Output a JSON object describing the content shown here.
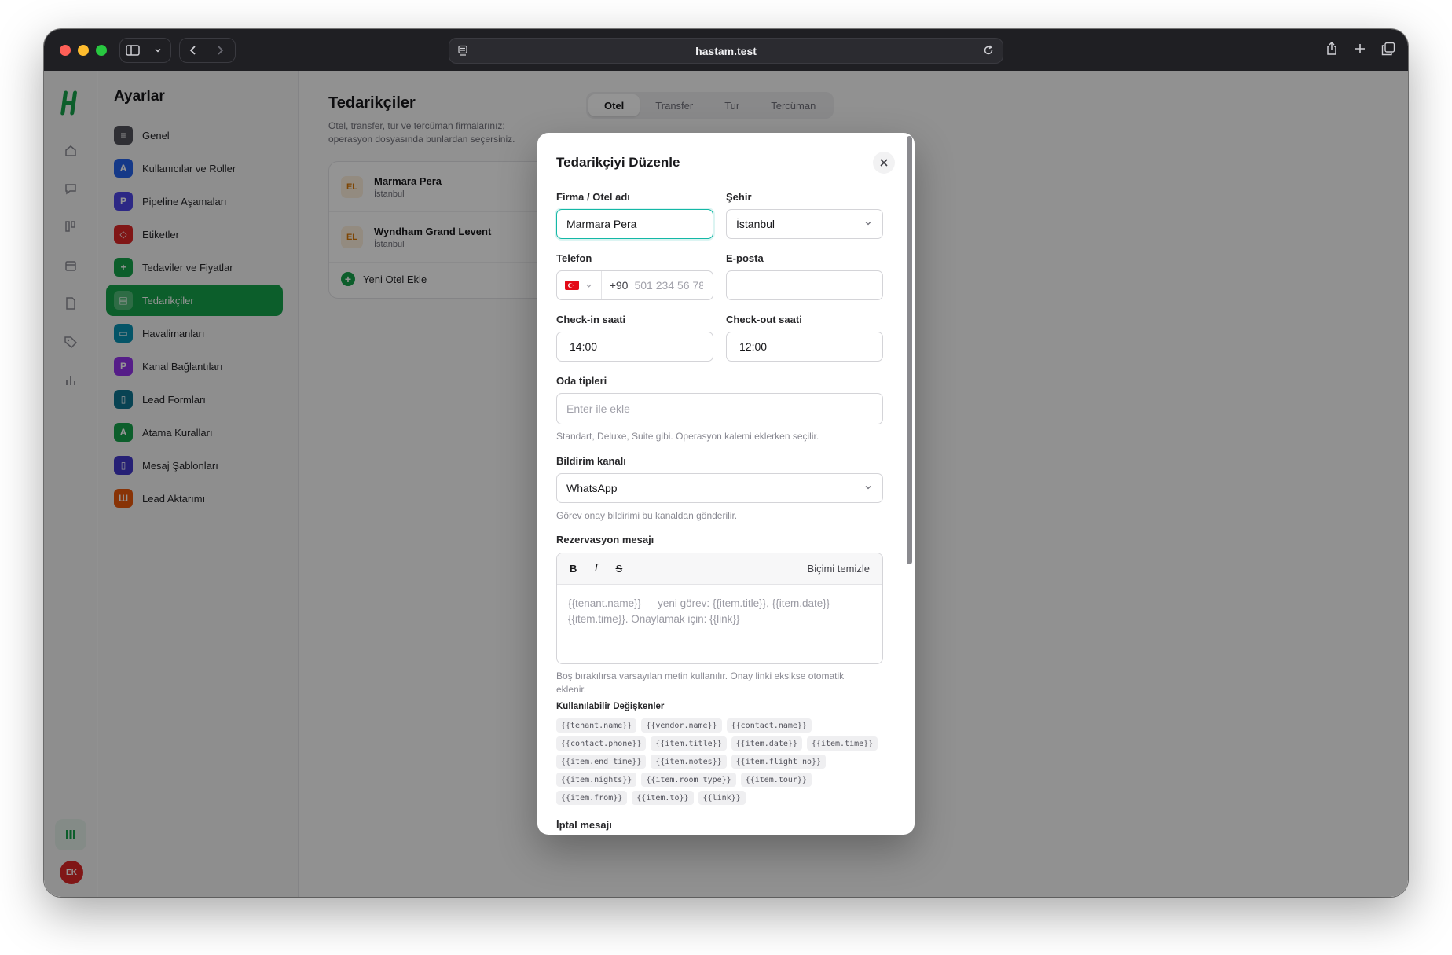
{
  "browser": {
    "url": "hastam.test"
  },
  "rail": {
    "avatar_initials": "EK",
    "icons": [
      "home-icon",
      "chat-icon",
      "pipeline-icon",
      "calendar-icon",
      "document-icon",
      "tags-icon",
      "chart-icon"
    ]
  },
  "settings": {
    "title": "Ayarlar",
    "items": [
      {
        "label": "Genel",
        "color": "#52525b",
        "glyph": "≡"
      },
      {
        "label": "Kullanıcılar ve Roller",
        "color": "#2563eb",
        "glyph": "A"
      },
      {
        "label": "Pipeline Aşamaları",
        "color": "#4f46e5",
        "glyph": "P"
      },
      {
        "label": "Etiketler",
        "color": "#dc2626",
        "glyph": "◇"
      },
      {
        "label": "Tedaviler ve Fiyatlar",
        "color": "#16a34a",
        "glyph": "+"
      },
      {
        "label": "Tedarikçiler",
        "color": "#15803d",
        "glyph": "▤",
        "active": true
      },
      {
        "label": "Havalimanları",
        "color": "#0891b2",
        "glyph": "▭"
      },
      {
        "label": "Kanal Bağlantıları",
        "color": "#9333ea",
        "glyph": "P"
      },
      {
        "label": "Lead Formları",
        "color": "#0e7490",
        "glyph": "▯"
      },
      {
        "label": "Atama Kuralları",
        "color": "#16a34a",
        "glyph": "A"
      },
      {
        "label": "Mesaj Şablonları",
        "color": "#4338ca",
        "glyph": "▯"
      },
      {
        "label": "Lead Aktarımı",
        "color": "#ea580c",
        "glyph": "Ш"
      }
    ]
  },
  "main": {
    "title": "Tedarikçiler",
    "description": "Otel, transfer, tur ve tercüman firmalarınız; operasyon dosyasında bunlardan seçersiniz.",
    "tabs": [
      "Otel",
      "Transfer",
      "Tur",
      "Tercüman"
    ],
    "active_tab": "Otel",
    "vendors": [
      {
        "badge": "EL",
        "name": "Marmara Pera",
        "city": "İstanbul"
      },
      {
        "badge": "EL",
        "name": "Wyndham Grand Levent",
        "city": "İstanbul"
      }
    ],
    "add_label": "Yeni Otel Ekle"
  },
  "modal": {
    "title": "Tedarikçiyi Düzenle",
    "name_label": "Firma / Otel adı",
    "name_value": "Marmara Pera",
    "city_label": "Şehir",
    "city_value": "İstanbul",
    "phone_label": "Telefon",
    "phone_code": "+90",
    "phone_placeholder": "501 234 56 78",
    "email_label": "E-posta",
    "email_value": "",
    "checkin_label": "Check-in saati",
    "checkin_value": "14:00",
    "checkout_label": "Check-out saati",
    "checkout_value": "12:00",
    "room_label": "Oda tipleri",
    "room_placeholder": "Enter ile ekle",
    "room_hint": "Standart, Deluxe, Suite gibi. Operasyon kalemi eklerken seçilir.",
    "channel_label": "Bildirim kanalı",
    "channel_value": "WhatsApp",
    "channel_hint": "Görev onay bildirimi bu kanaldan gönderilir.",
    "reservation_label": "Rezervasyon mesajı",
    "editor_bold": "B",
    "editor_italic": "I",
    "editor_strike": "S",
    "editor_clear": "Biçimi temizle",
    "editor_placeholder": "{{tenant.name}} — yeni görev: {{item.title}}, {{item.date}} {{item.time}}. Onaylamak için: {{link}}",
    "reservation_hint": "Boş bırakılırsa varsayılan metin kullanılır. Onay linki eksikse otomatik eklenir.",
    "vars_title": "Kullanılabilir Değişkenler",
    "variables": [
      "{{tenant.name}}",
      "{{vendor.name}}",
      "{{contact.name}}",
      "{{contact.phone}}",
      "{{item.title}}",
      "{{item.date}}",
      "{{item.time}}",
      "{{item.end_time}}",
      "{{item.notes}}",
      "{{item.flight_no}}",
      "{{item.nights}}",
      "{{item.room_type}}",
      "{{item.tour}}",
      "{{item.from}}",
      "{{item.to}}",
      "{{link}}"
    ],
    "cancel_label": "İptal mesajı"
  }
}
